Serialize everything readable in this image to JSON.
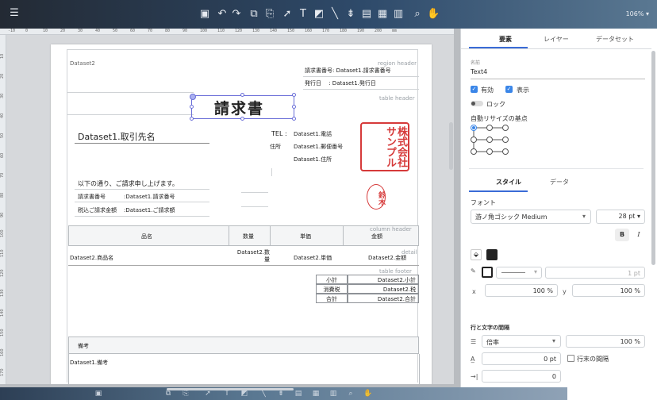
{
  "topbar": {
    "zoom": "106% ▾"
  },
  "ruler": {
    "h": [
      "-10",
      "0",
      "10",
      "20",
      "30",
      "40",
      "50",
      "60",
      "70",
      "80",
      "90",
      "100",
      "110",
      "120",
      "130",
      "140",
      "150",
      "160",
      "170",
      "180",
      "190",
      "200",
      "mm"
    ],
    "v": [
      "10",
      "20",
      "30",
      "40",
      "50",
      "60",
      "70",
      "80",
      "90",
      "100",
      "110",
      "120",
      "130",
      "140",
      "150",
      "160",
      "170"
    ]
  },
  "report": {
    "dataset2_label": "Dataset2",
    "region_header": "region header",
    "invoice_no_label": "請求書番号: Dataset1.請求書番号",
    "issue_date_label": "発行日　 : Dataset1.発行日",
    "table_header_hint": "table header",
    "title": "請求書",
    "client_name": "Dataset1.取引先名",
    "tel_label": "TEL :",
    "tel_value": "Dataset1.電話",
    "addr_label": "住所",
    "postal_value": "Dataset1.郵便番号",
    "addr_value": "Dataset1.住所",
    "stamp_big": "株式会社サンプル",
    "stamp_small": "鈴木",
    "intro": "以下の通り、ご請求申し上げます。",
    "invoice_no_row_label": "請求書番号",
    "invoice_no_row_value": ":Dataset1.請求番号",
    "total_row_label": "税込ご請求金額",
    "total_row_value": ":Dataset1.ご請求額",
    "col_name": "品名",
    "col_qty": "数量",
    "col_unit": "単価",
    "col_amount": "金額",
    "column_header_hint": "column header",
    "detail_hint": "detail",
    "row_name": "Dataset2.商品名",
    "row_qty": "Dataset2.数量",
    "row_unit": "Dataset2.単価",
    "row_amount": "Dataset2.金額",
    "subtotal_label": "小計",
    "subtotal_value": "Dataset2.小計",
    "tax_label": "消費税",
    "tax_value": "Dataset2.税",
    "total_label": "合計",
    "total_value": "Dataset2.合計",
    "table_footer_hint": "table footer",
    "notes_label": "備考",
    "notes_value": "Dataset1.備考"
  },
  "panel": {
    "tabs": [
      "要素",
      "レイヤー",
      "データセット"
    ],
    "name_label": "名前",
    "name_value": "Text4",
    "enabled_label": "有効",
    "visible_label": "表示",
    "lock_label": "ロック",
    "autosize_label": "自動リサイズの基点",
    "subtabs": [
      "スタイル",
      "データ"
    ],
    "font_label": "フォント",
    "font_value": "游ノ角ゴシック Medium",
    "font_size": "28 pt ▾",
    "bold": "B",
    "italic": "I",
    "stroke_width": "1 pt",
    "x_label": "x",
    "x_value": "100 %",
    "y_label": "y",
    "y_value": "100 %",
    "spacing_label": "行と文字の間隔",
    "line_mode": "倍率",
    "line_value": "100 %",
    "char_value": "0 pt",
    "line_end_label": "行末の間隔",
    "indent_value": "0"
  }
}
